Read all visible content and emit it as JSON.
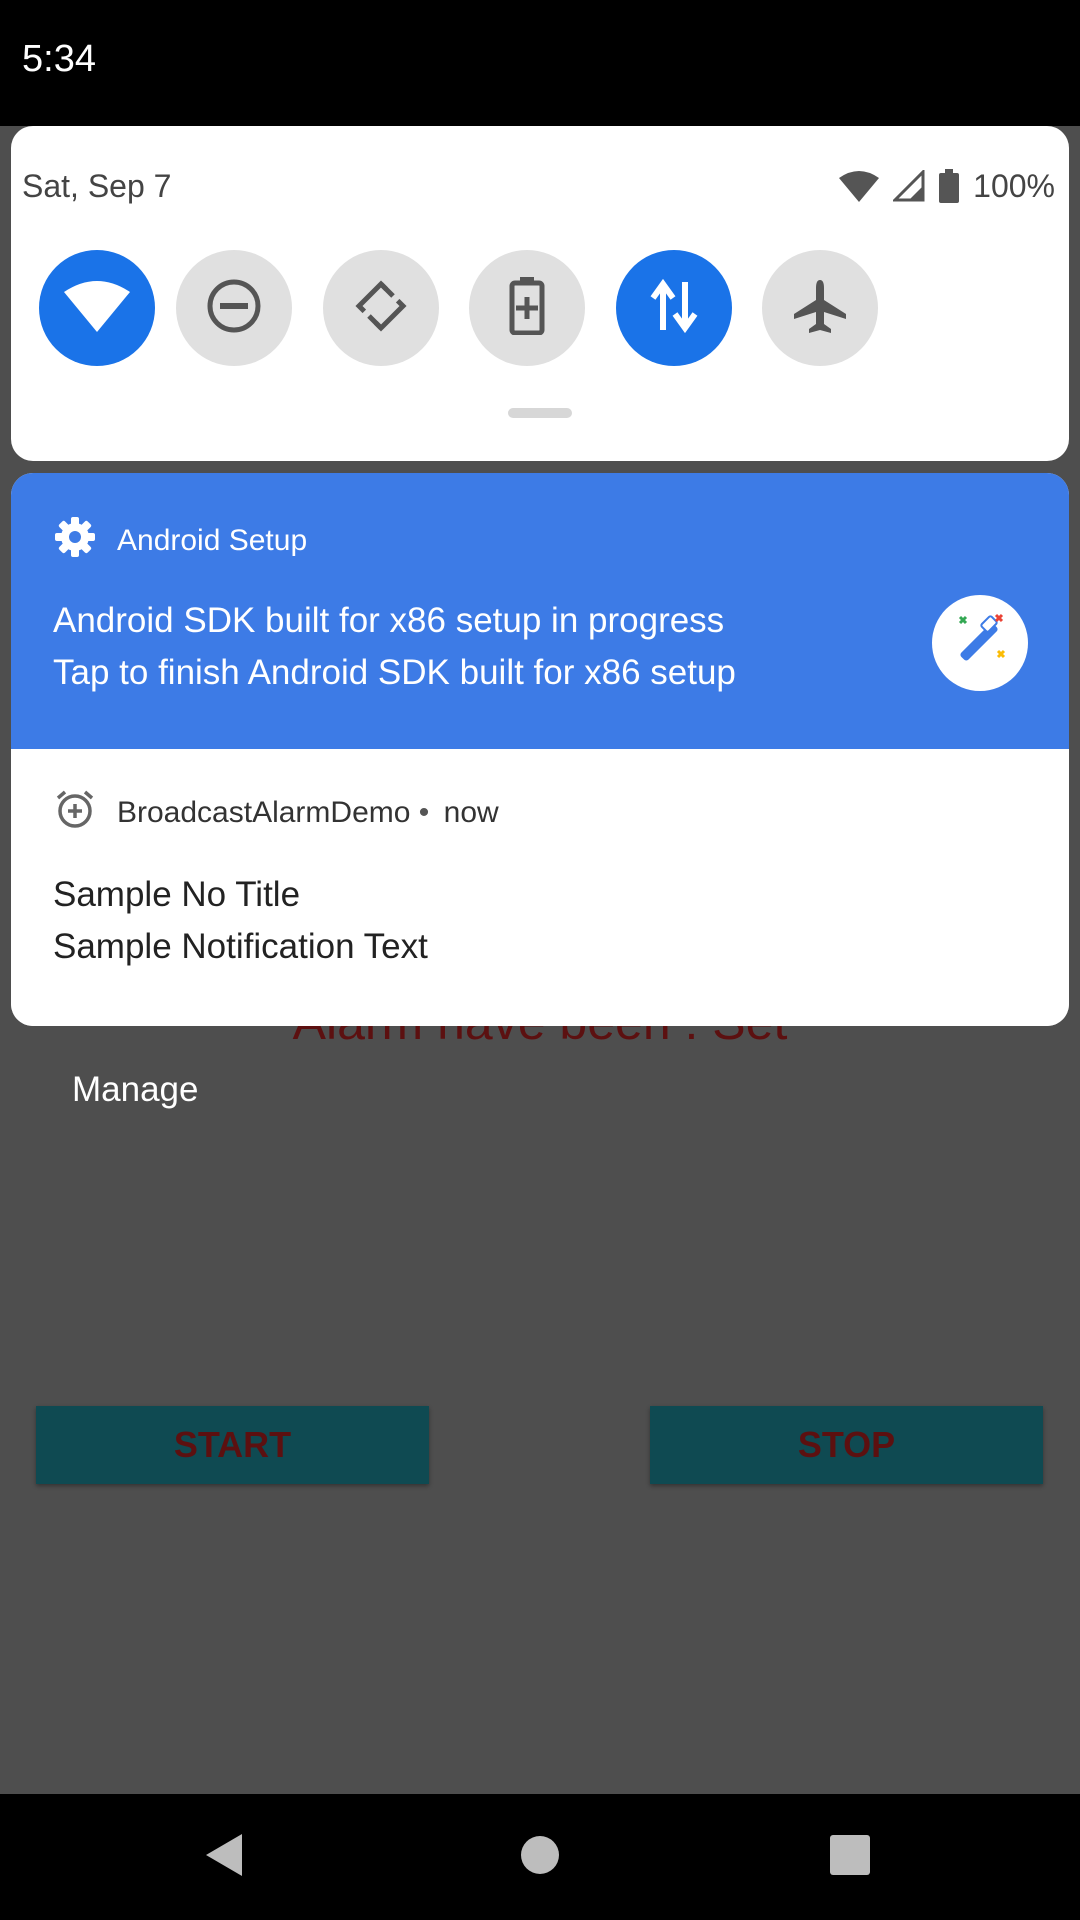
{
  "status_bar": {
    "time": "5:34"
  },
  "quick_settings": {
    "date": "Sat, Sep 7",
    "battery_percent": "100%",
    "tiles": [
      {
        "name": "wifi",
        "active": true
      },
      {
        "name": "do-not-disturb",
        "active": false
      },
      {
        "name": "auto-rotate",
        "active": false
      },
      {
        "name": "battery-saver",
        "active": false
      },
      {
        "name": "mobile-data",
        "active": true
      },
      {
        "name": "airplane-mode",
        "active": false
      }
    ]
  },
  "notifications": {
    "setup": {
      "app_name": "Android Setup",
      "line1": "Android SDK built for x86 setup in progress",
      "line2": "Tap to finish Android SDK built for x86 setup",
      "accent_color": "#3d7be6"
    },
    "alarm": {
      "app_name": "BroadcastAlarmDemo",
      "separator": "•",
      "time": "now",
      "title": "Sample No Title",
      "text": "Sample Notification Text"
    },
    "manage_label": "Manage"
  },
  "app": {
    "status_text": "Alarm have been : Set",
    "start_label": "START",
    "stop_label": "STOP"
  },
  "colors": {
    "tile_active": "#1a73e8",
    "tile_inactive": "#e0e0e0",
    "scrim": "#4e4e4e"
  }
}
